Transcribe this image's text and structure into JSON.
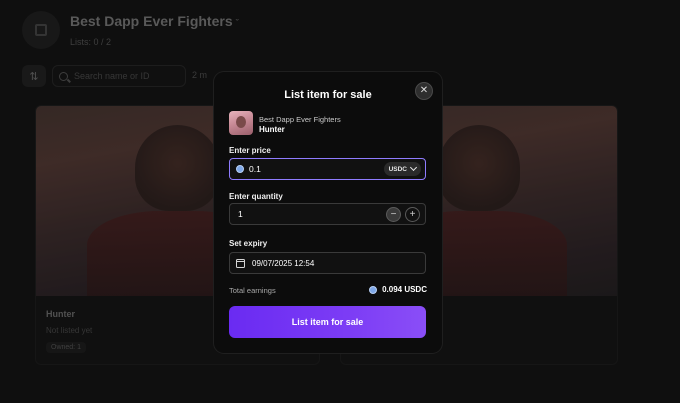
{
  "background": {
    "collection_title": "Best Dapp Ever Fighters",
    "verified_mark": "ˇ",
    "listed_text": "Lists: 0 / 2",
    "search_placeholder": "Search name or ID",
    "more_text": "2 m",
    "cards": [
      {
        "name": "Hunter",
        "status": "Not listed yet",
        "owned": "Owned: 1"
      },
      {
        "name": "",
        "status": "",
        "owned": ""
      }
    ]
  },
  "modal": {
    "title": "List item for sale",
    "close_icon": "close-icon",
    "item": {
      "collection": "Best Dapp Ever Fighters",
      "name": "Hunter"
    },
    "price": {
      "label": "Enter price",
      "value": "0.1",
      "currency": "USDC"
    },
    "quantity": {
      "label": "Enter quantity",
      "value": "1",
      "minus": "−",
      "plus": "+"
    },
    "expiry": {
      "label": "Set expiry",
      "value": "09/07/2025 12:54"
    },
    "earnings": {
      "label": "Total earnings",
      "value": "0.094 USDC"
    },
    "submit_label": "List item for sale"
  },
  "colors": {
    "accent": "#7c3cf5",
    "focus_border": "#8f7cff",
    "coin": "#7fa8e8"
  }
}
